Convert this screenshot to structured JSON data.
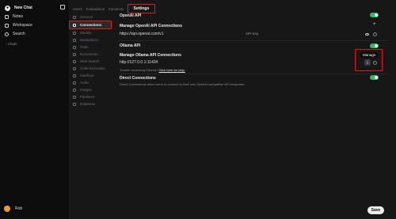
{
  "sidebar": {
    "new_chat": "New Chat",
    "items": [
      {
        "label": "Notes",
        "icon": "notes-icon"
      },
      {
        "label": "Workspace",
        "icon": "workspace-icon"
      },
      {
        "label": "Search",
        "icon": "search-icon"
      }
    ],
    "chats_label": "Chats",
    "user_name": "Rob"
  },
  "tabs": {
    "users": "Users",
    "evaluations": "Evaluations",
    "functions": "Functions",
    "settings": "Settings"
  },
  "settings_nav": [
    {
      "label": "General"
    },
    {
      "label": "Connections"
    },
    {
      "label": "Models"
    },
    {
      "label": "Evaluations"
    },
    {
      "label": "Tools"
    },
    {
      "label": "Documents"
    },
    {
      "label": "Web Search"
    },
    {
      "label": "Code Execution"
    },
    {
      "label": "Interface"
    },
    {
      "label": "Audio"
    },
    {
      "label": "Images"
    },
    {
      "label": "Pipelines"
    },
    {
      "label": "Database"
    }
  ],
  "connections": {
    "openai_api": "OpenAI API",
    "manage_openai": "Manage OpenAI API Connections",
    "openai_url": "https://api.openai.com/v1",
    "api_key": "API Key",
    "ollama_api": "Ollama API",
    "manage_ollama": "Manage Ollama API Connections",
    "ollama_url": "http://127.0.0.1:11434",
    "trouble_text": "Trouble accessing Ollama?",
    "help_link": "Click here for help.",
    "manage_tooltip": "Manage",
    "direct_connections": "Direct Connections",
    "direct_desc": "Direct Connections allow users to connect to their own OpenAI compatible API endpoints."
  },
  "save_label": "Save",
  "colors": {
    "accent_toggle": "#2bbf5b",
    "highlight_box": "#e0181e",
    "avatar": "#f29a2e"
  }
}
